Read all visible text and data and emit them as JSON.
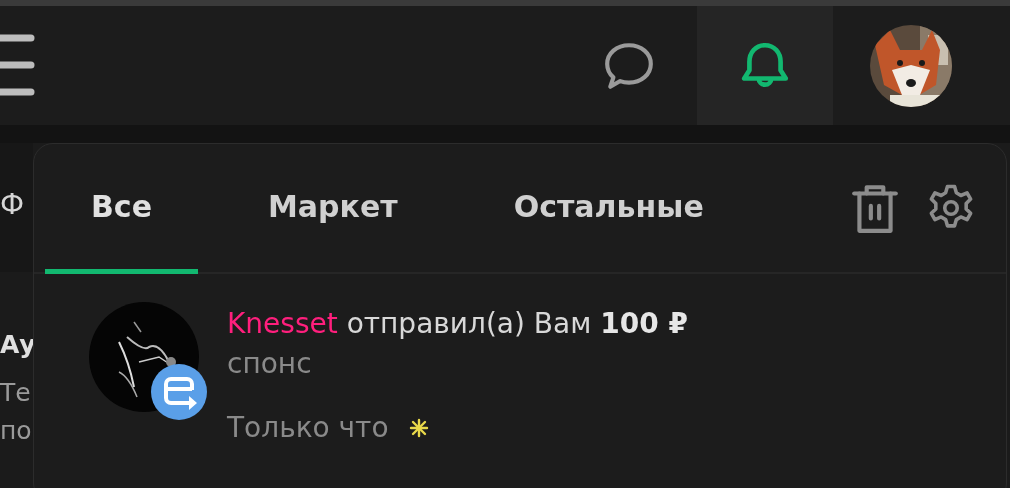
{
  "header": {
    "notifications_active": true
  },
  "background_text": [
    {
      "text": "Ф",
      "kind": "tab"
    },
    {
      "text": "Ау",
      "kind": "title"
    },
    {
      "text": "Те",
      "kind": "body"
    },
    {
      "text": "по",
      "kind": "body"
    }
  ],
  "popup": {
    "tabs": [
      {
        "label": "Все",
        "selected": true
      },
      {
        "label": "Маркет",
        "selected": false
      },
      {
        "label": "Остальные",
        "selected": false
      }
    ],
    "notifications": [
      {
        "sender": "Knesset",
        "text": "отправил(а) Вам **100 ₽**",
        "comment": "спонс",
        "time": "Только что",
        "unread": true
      }
    ]
  }
}
